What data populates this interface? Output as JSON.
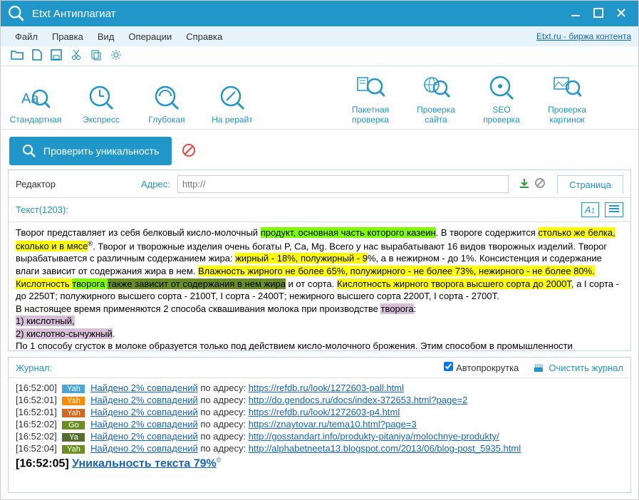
{
  "title": "Etxt Антиплагиат",
  "extlink": "Etxt.ru - биржа контента",
  "menu": {
    "file": "Файл",
    "edit": "Правка",
    "view": "Вид",
    "ops": "Операции",
    "help": "Справка"
  },
  "modes": {
    "std": "Стандартная",
    "exp": "Экспресс",
    "deep": "Глубокая",
    "rew": "На рерайт",
    "batch": "Пакетная\nпроверка",
    "site": "Проверка\nсайта",
    "seo": "SEO\nпроверка",
    "img": "Проверка\nкартинок"
  },
  "check_btn": "Проверить уникальность",
  "editor_label": "Редактор",
  "addr_label": "Адрес:",
  "addr_placeholder": "http://",
  "tab_page": "Страница",
  "text_header": "Текст(1203):",
  "body": {
    "p1a": "Творог представляет из себя белковый кисло-молочный ",
    "p1b": "продукт, основная часть которого казеин",
    "p1c": ". В твороге содержится ",
    "p1d": "столько же белка, сколько и в мясе",
    "p1e": ". Творог и творожные изделия очень богаты P, Ca, Mg. Всего у нас вырабатывают 16 видов творожных изделий. Творог вырабатывается с различным содержанием жира: ",
    "p1f": "жирный - 18%, полужирный - 9",
    "p1g": "%, а в нежирном - до 1%. Консистенция и содержание влаги зависит от содержания жира в нем. ",
    "p1h": "Влажность жирного не более 65%, полужирного - не более 73%, нежирного - не более 80%. Кислотность ",
    "p1i": "творога ",
    "p1j": "также зависит от содержания в нем жира",
    "p1k": " и от сорта. ",
    "p1l": "Кислотность жирного творога высшего сорта до 2000Т",
    "p1m": ", а I сорта - до 2250Т; полужирного высшего сорта - 2100Т, I сорта - 2400Т; нежирного высшего сорта 2200Т, I сорта - 2700Т.",
    "p2a": "В настоящее время применяются 2 способа сквашивания молока при производстве ",
    "p2b": "творога",
    "p2c": ":",
    "p3": "1) кислотный,",
    "p4": "2) кислотно-сычужный",
    "p4b": ".",
    "p5": "По 1 способу сгусток в молоке образуется только под действием кисло-молочного брожения. Этим способом в промышленности"
  },
  "log_title": "Журнал:",
  "autoscroll": "Автопрокрутка",
  "clear": "Очистить журнал",
  "log": [
    {
      "t": "[16:52:00]",
      "b": "Yah",
      "bc": "b-blue",
      "a": "Найдено 2% совпадений",
      "mid": " по адресу: ",
      "u": "https://refdb.ru/look/1272603-pall.html"
    },
    {
      "t": "[16:52:01]",
      "b": "Yah",
      "bc": "b-orange",
      "a": "Найдено 2% совпадений",
      "mid": " по адресу: ",
      "u": "http://do.gendocs.ru/docs/index-372653.html?page=2"
    },
    {
      "t": "[16:52:01]",
      "b": "Yah",
      "bc": "b-dorange",
      "a": "Найдено 2% совпадений",
      "mid": " по адресу: ",
      "u": "https://refdb.ru/look/1272603-p4.html"
    },
    {
      "t": "[16:52:02]",
      "b": "Go",
      "bc": "b-green",
      "a": "Найдено 2% совпадений",
      "mid": " по адресу: ",
      "u": "https://znaytovar.ru/tema10.html?page=3"
    },
    {
      "t": "[16:52:02]",
      "b": "Ya",
      "bc": "b-dgreen",
      "a": "Найдено 2% совпадений",
      "mid": " по адресу: ",
      "u": "http://gosstandart.info/produkty-pitaniya/molochnye-produkty/"
    },
    {
      "t": "[16:52:04]",
      "b": "Yah",
      "bc": "b-green",
      "a": "Найдено 2% совпадений",
      "mid": " по адресу: ",
      "u": "http://alphabetneeta13.blogspot.com/2013/06/blog-post_5935.html"
    }
  ],
  "final_time": "[16:52:05] ",
  "final_text": "Уникальность текста 79%"
}
